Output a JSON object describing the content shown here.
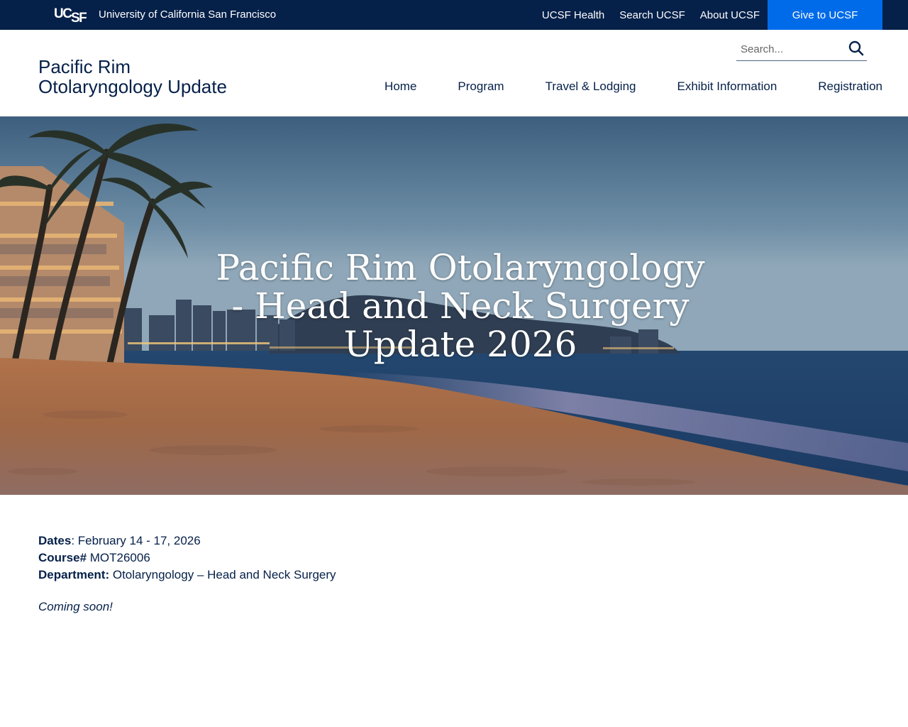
{
  "utility_bar": {
    "logo_text": "UCSF",
    "wordmark": "University of California San Francisco",
    "links": [
      "UCSF Health",
      "Search UCSF",
      "About UCSF"
    ],
    "give_label": "Give to UCSF",
    "background_color": "#052049",
    "give_color": "#006be9"
  },
  "header": {
    "site_title_line1": "Pacific Rim",
    "site_title_line2": "Otolaryngology Update",
    "search": {
      "placeholder": "Search...",
      "value": "",
      "icon": "search-icon"
    },
    "nav": [
      "Home",
      "Program",
      "Travel & Lodging",
      "Exhibit Information",
      "Registration"
    ]
  },
  "hero": {
    "title": "Pacific Rim Otolaryngology - Head and Neck Surgery Update 2026",
    "image_subject": "beach-at-dusk"
  },
  "course": {
    "dates_label": "Dates",
    "dates_value": ": February 14 - 17, 2026",
    "course_label": "Course#",
    "course_value": " MOT26006",
    "department_label": "Department:",
    "department_value": " Otolaryngology – Head and Neck Surgery",
    "status": "Coming soon!"
  }
}
